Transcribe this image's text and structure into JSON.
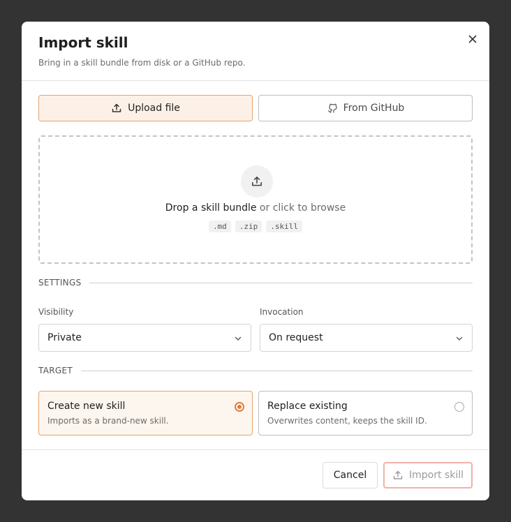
{
  "header": {
    "title": "Import skill",
    "subtitle": "Bring in a skill bundle from disk or a GitHub repo."
  },
  "tabs": {
    "upload_label": "Upload file",
    "github_label": "From GitHub",
    "active": "upload"
  },
  "dropzone": {
    "strong": "Drop a skill bundle",
    "rest": " or click to browse",
    "extensions": [
      ".md",
      ".zip",
      ".skill"
    ]
  },
  "settings": {
    "heading": "SETTINGS",
    "visibility_label": "Visibility",
    "visibility_value": "Private",
    "invocation_label": "Invocation",
    "invocation_value": "On request"
  },
  "target": {
    "heading": "TARGET",
    "options": [
      {
        "title": "Create new skill",
        "desc": "Imports as a brand-new skill.",
        "selected": true
      },
      {
        "title": "Replace existing",
        "desc": "Overwrites content, keeps the skill ID.",
        "selected": false
      }
    ]
  },
  "footer": {
    "cancel_label": "Cancel",
    "import_label": "Import skill"
  },
  "colors": {
    "accent": "#e07b39",
    "accent_bg": "#fdf1e7",
    "overlay": "#333333"
  },
  "icons": [
    "close-icon",
    "upload-icon",
    "github-icon",
    "chevron-down-icon"
  ]
}
